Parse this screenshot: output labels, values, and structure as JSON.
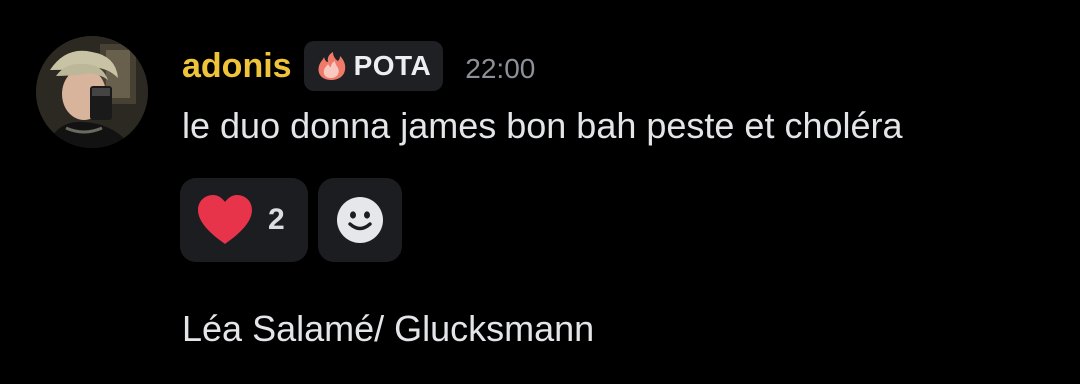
{
  "message": {
    "author": {
      "name": "adonis",
      "name_color": "#f0c43a",
      "avatar_icon": "user-avatar"
    },
    "tag": {
      "icon": "fire-icon",
      "label": "POTA"
    },
    "timestamp": "22:00",
    "text": "le duo donna james bon bah peste et choléra",
    "reactions": [
      {
        "emoji": "heart-icon",
        "emoji_color": "#e8344b",
        "count": "2"
      }
    ],
    "add_reaction_icon": "add-reaction-smiley-icon"
  },
  "next_message": {
    "text": "Léa Salamé/ Glucksmann"
  }
}
